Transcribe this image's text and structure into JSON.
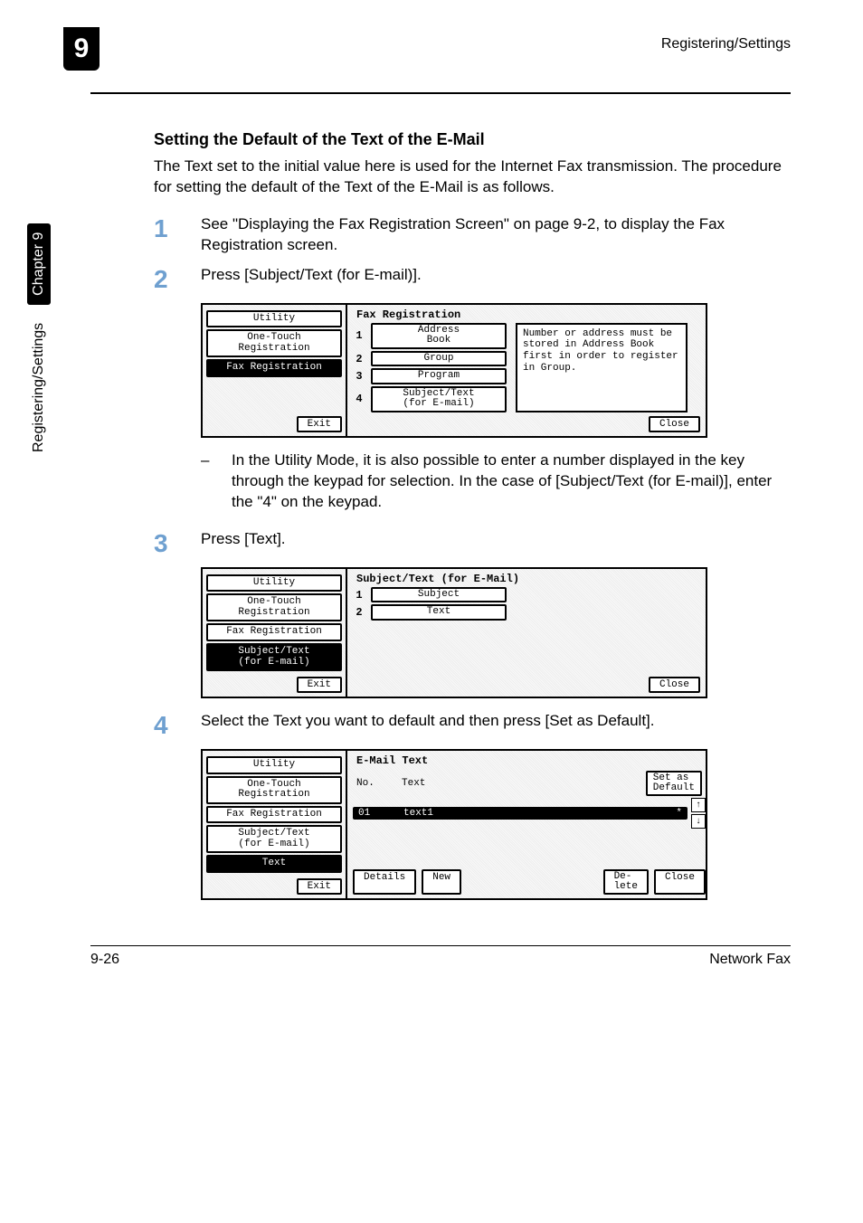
{
  "header": {
    "tab_number": "9",
    "right": "Registering/Settings"
  },
  "side": {
    "label1": "Registering/Settings",
    "label2": "Chapter 9"
  },
  "section_title": "Setting the Default of the Text of the E-Mail",
  "intro": "The Text set to the initial value here is used for the Internet Fax transmission. The procedure for setting the default of the Text of the E-Mail is as follows.",
  "steps": {
    "s1": "See \"Displaying the Fax Registration Screen\" on page 9-2, to display the Fax Registration screen.",
    "s2": "Press [Subject/Text (for E-mail)].",
    "s3": "Press [Text].",
    "s4": "Select the Text you want to default and then press [Set as Default]."
  },
  "sub_note": "In the Utility Mode, it is also possible to enter a number displayed in the key through the keypad for selection. In the case of [Subject/Text (for E-mail)], enter the \"4\" on the keypad.",
  "common": {
    "utility": "Utility",
    "one_touch": "One-Touch\nRegistration",
    "fax_reg": "Fax Registration",
    "subj_text": "Subject/Text\n(for E-mail)",
    "text_tab": "Text",
    "exit": "Exit",
    "close": "Close"
  },
  "panel1": {
    "title": "Fax Registration",
    "options": {
      "n1": "1",
      "b1": "Address\nBook",
      "n2": "2",
      "b2": "Group",
      "n3": "3",
      "b3": "Program",
      "n4": "4",
      "b4": "Subject/Text\n(for E-mail)"
    },
    "message": "Number or address must be stored in Address Book first in order to register in Group."
  },
  "panel2": {
    "title": "Subject/Text (for E-Mail)",
    "options": {
      "n1": "1",
      "b1": "Subject",
      "n2": "2",
      "b2": "Text"
    }
  },
  "panel3": {
    "title": "E-Mail Text",
    "cols": {
      "no": "No.",
      "text": "Text"
    },
    "set_default": "Set as\nDefault",
    "row": {
      "no": "01",
      "text": "text1",
      "star": "*"
    },
    "buttons": {
      "details": "Details",
      "new": "New",
      "delete": "De-\nlete"
    },
    "scroll": {
      "up": "↑",
      "down": "↓"
    }
  },
  "footer": {
    "left": "9-26",
    "right": "Network Fax"
  }
}
